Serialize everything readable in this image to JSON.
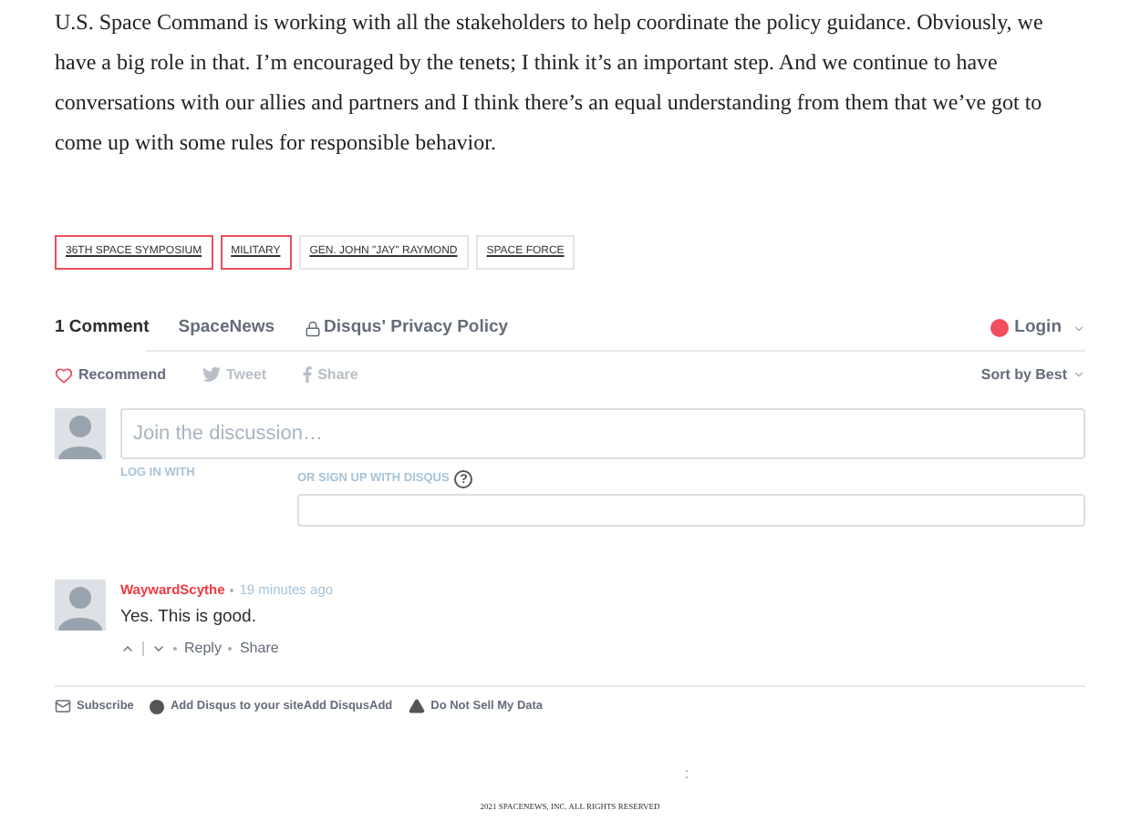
{
  "article": {
    "paragraph": "U.S. Space Command is working with all the stakeholders to help coordinate the policy guidance. Obviously, we have a big role in that. I’m encouraged by the tenets; I think it’s an important step. And we continue to have conversations with our allies and partners and I think there’s an equal understanding from them that we’ve got to come up with some rules for responsible behavior."
  },
  "tags": [
    {
      "label": "36TH SPACE SYMPOSIUM",
      "highlighted": true
    },
    {
      "label": "MILITARY",
      "highlighted": true
    },
    {
      "label": "GEN. JOHN \"JAY\" RAYMOND",
      "highlighted": false
    },
    {
      "label": "SPACE FORCE",
      "highlighted": false
    }
  ],
  "comments_header": {
    "tabs": [
      {
        "label": "1 Comment",
        "selected": true
      },
      {
        "label": "SpaceNews",
        "selected": false
      },
      {
        "label": "Disqus' Privacy Policy",
        "selected": false
      }
    ],
    "login": "Login",
    "actions": [
      "Recommend",
      "Tweet",
      "Share"
    ],
    "sort": "Sort by Best"
  },
  "compose": {
    "placeholder": "Join the discussion…",
    "log_in_with": "LOG IN WITH",
    "sign_up": "OR SIGN UP WITH DISQUS",
    "help": "?"
  },
  "comments": [
    {
      "author": "WaywardScythe",
      "time": "19 minutes ago",
      "text": "Yes. This is good.",
      "actions": [
        "Reply",
        "Share"
      ]
    }
  ],
  "footer_links": [
    "Subscribe",
    "Add Disqus to your siteAdd DisqusAdd",
    "Do Not Sell My Data"
  ],
  "page_footer": {
    "mark": ":",
    "copyright": "2021 SPACENEWS, INC. ALL RIGHTS RESERVED"
  }
}
